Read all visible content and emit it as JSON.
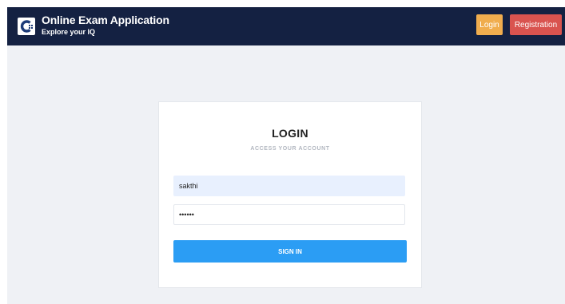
{
  "header": {
    "logo_icon": "c-logo-icon",
    "title": "Online Exam Application",
    "subtitle": "Explore your IQ",
    "login_label": "Login",
    "registration_label": "Registration"
  },
  "login_card": {
    "title": "LOGIN",
    "subtitle": "ACCESS YOUR ACCOUNT",
    "username_value": "sakthi",
    "password_value": "••••••",
    "signin_label": "SIGN IN"
  },
  "colors": {
    "navbar": "#142142",
    "login_button": "#f0ad4e",
    "registration_button": "#d9534f",
    "signin_button": "#2b9df4",
    "page_background": "#eff1f5"
  }
}
